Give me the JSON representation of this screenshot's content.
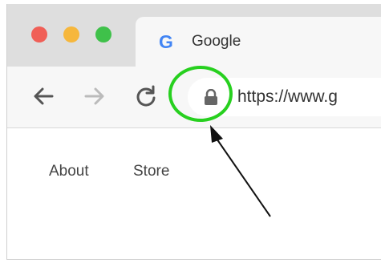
{
  "window": {
    "controls": [
      "close",
      "minimize",
      "maximize"
    ]
  },
  "tab": {
    "icon": "G",
    "title": "Google"
  },
  "toolbar": {
    "back_icon": "back-arrow-icon",
    "forward_icon": "forward-arrow-icon",
    "reload_icon": "reload-icon"
  },
  "address_bar": {
    "lock_icon": "lock-icon",
    "url": "https://www.g"
  },
  "page": {
    "nav_links": [
      "About",
      "Store"
    ]
  },
  "annotation": {
    "highlight_color": "#27d01f",
    "arrow_color": "#111111"
  }
}
